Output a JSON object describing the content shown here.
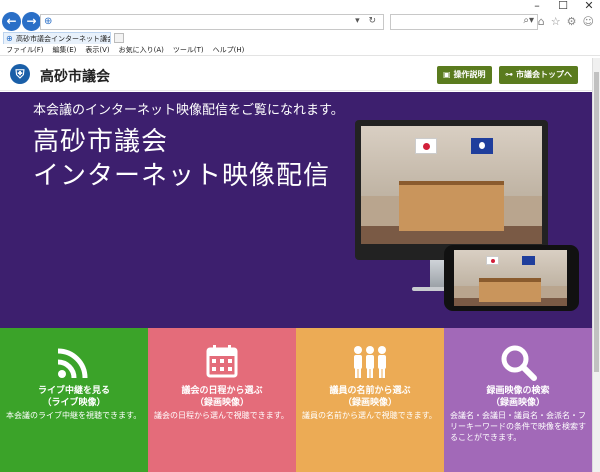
{
  "browser": {
    "window_controls": [
      "–",
      "☐",
      "✕"
    ],
    "back_icon": "back-arrow-icon",
    "forward_icon": "forward-arrow-icon",
    "address_value": "",
    "tab_title": "高砂市議会インターネット議会...",
    "menu_items": [
      "ファイル(F)",
      "編集(E)",
      "表示(V)",
      "お気に入り(A)",
      "ツール(T)",
      "ヘルプ(H)"
    ]
  },
  "site": {
    "title": "高砂市議会",
    "header_buttons": {
      "help": "操作説明",
      "top": "市議会トップへ"
    },
    "accent_green": "#5a7b1e"
  },
  "hero": {
    "subtitle": "本会議のインターネット映像配信をご覧になれます。",
    "title_line1": "高砂市議会",
    "title_line2": "インターネット映像配信",
    "background": "#3d1f6e"
  },
  "tiles": [
    {
      "title": "ライブ中継を見る\n（ライブ映像）",
      "desc": "本会議のライブ中継を視聴できます。",
      "color": "#3ba329",
      "icon": "wifi-signal-icon"
    },
    {
      "title": "議会の日程から選ぶ\n（録画映像）",
      "desc": "議会の日程から選んで視聴できます。",
      "color": "#e46c7a",
      "icon": "calendar-icon"
    },
    {
      "title": "議員の名前から選ぶ\n（録画映像）",
      "desc": "議員の名前から選んで視聴できます。",
      "color": "#ecab55",
      "icon": "people-icon"
    },
    {
      "title": "録画映像の検索\n（録画映像）",
      "desc": "会議名・会議日・議員名・会派名・フリーキーワードの条件で映像を検索することができます。",
      "color": "#a269b8",
      "icon": "magnifier-icon"
    }
  ]
}
